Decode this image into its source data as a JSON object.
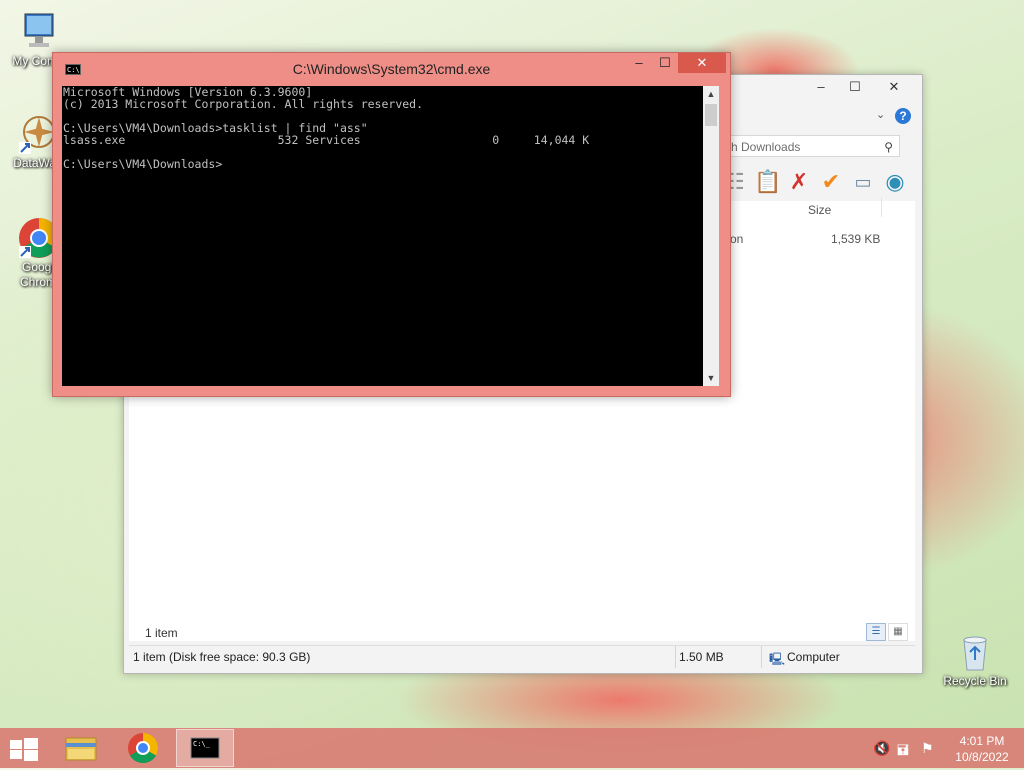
{
  "desktop": {
    "icons": [
      {
        "label": "My Comp",
        "icon": "computer-icon"
      },
      {
        "label": "DataWag",
        "icon": "datawag-icon"
      },
      {
        "label": "Googl\nChrom",
        "label_line1": "Googl",
        "label_line2": "Chrom",
        "icon": "chrome-icon"
      },
      {
        "label": "Recycle Bin",
        "icon": "recycle-bin-icon"
      }
    ]
  },
  "explorer": {
    "search_placeholder": "rch Downloads",
    "column_size": "Size",
    "row": {
      "type_fragment": "tion",
      "size": "1,539 KB"
    },
    "item_count": "1 item",
    "status": {
      "left": "1 item (Disk free space: 90.3 GB)",
      "size": "1.50 MB",
      "location": "Computer"
    },
    "help": "?"
  },
  "cmd": {
    "title": "C:\\Windows\\System32\\cmd.exe",
    "lines": [
      "Microsoft Windows [Version 6.3.9600]",
      "(c) 2013 Microsoft Corporation. All rights reserved.",
      "",
      "C:\\Users\\VM4\\Downloads>tasklist | find \"ass\"",
      "lsass.exe                      532 Services                   0     14,044 K",
      "",
      "C:\\Users\\VM4\\Downloads>"
    ]
  },
  "taskbar": {
    "apps": [
      "file-explorer-icon",
      "chrome-icon",
      "cmd-icon"
    ],
    "clock": {
      "time": "4:01 PM",
      "date": "10/8/2022"
    }
  },
  "colors": {
    "accent": "#ef8e86",
    "close": "#d9594c",
    "console_bg": "#000000",
    "console_text": "#c0c0c0"
  }
}
